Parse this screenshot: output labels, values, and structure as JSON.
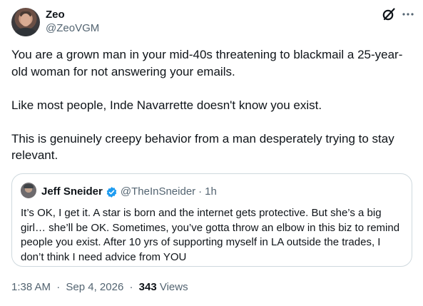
{
  "author": {
    "name": "Zeo",
    "handle": "@ZeoVGM"
  },
  "tweet": {
    "paragraphs": [
      "You are a grown man in your mid-40s threatening to blackmail a 25-year-old woman for not answering your emails.",
      "Like most people, Inde Navarrette doesn't know you exist.",
      "This is genuinely creepy behavior from a man desperately trying to stay relevant."
    ]
  },
  "quoted": {
    "name": "Jeff Sneider",
    "handle": "@TheInSneider",
    "dot": "·",
    "time": "1h",
    "text": "It’s OK, I get it. A star is born and the internet gets protective. But she’s a big girl… she’ll be OK. Sometimes, you’ve gotta throw an elbow in this biz to remind people you exist. After 10 yrs of supporting myself in LA outside the trades, I don’t think I need advice from YOU",
    "verified_color": "#1d9bf0"
  },
  "meta": {
    "time": "1:38 AM",
    "date": "Sep 4, 2026",
    "dot": "·",
    "views_count": "343",
    "views_label": "Views"
  },
  "icons": {
    "grok": "grok-icon",
    "more": "more-icon",
    "verified": "verified-badge-icon"
  }
}
